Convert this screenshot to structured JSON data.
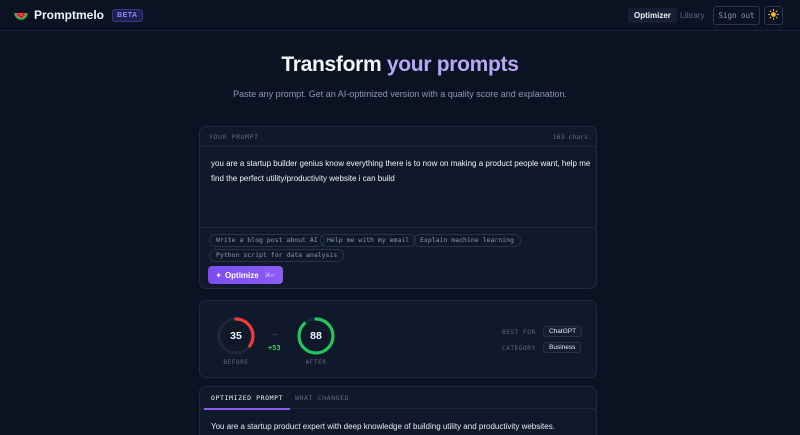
{
  "header": {
    "brand_name": "Promptmelo",
    "badge": "BETA",
    "logo_icon": "watermelon-icon",
    "nav": {
      "optimizer": "Optimizer",
      "library": "Library"
    },
    "sign_out": "Sign out",
    "theme_icon": "sun-icon"
  },
  "hero": {
    "title_part1": "Transform ",
    "title_part2": "your prompts",
    "subtitle": "Paste any prompt. Get an AI-optimized version with a quality score and explanation."
  },
  "prompt": {
    "label": "YOUR PROMPT",
    "char_count": "163 chars",
    "text": "you are a startup builder genius know everything there is to now on making a product people want, help me find the perfect utility/productivity website i can build",
    "suggestions": [
      "Write a blog post about AI",
      "Help me with my email",
      "Explain machine learning",
      "Python script for data analysis"
    ],
    "optimize_label": "Optimize",
    "optimize_icon": "sparkle-icon",
    "shortcut": "⌘↵"
  },
  "score": {
    "before": {
      "value": "35",
      "caption": "BEFORE",
      "fraction": 0.35,
      "color": "#ef3b3b"
    },
    "after": {
      "value": "88",
      "caption": "AFTER",
      "fraction": 0.88,
      "color": "#22c55e"
    },
    "delta": "+53",
    "arrow_icon": "arrow-right-icon",
    "best_for_label": "BEST FOR",
    "best_for_value": "ChatGPT",
    "category_label": "CATEGORY",
    "category_value": "Business"
  },
  "output": {
    "tabs": [
      "OPTIMIZED PROMPT",
      "WHAT CHANGED"
    ],
    "text": "You are a startup product expert with deep knowledge of building utility and productivity websites."
  },
  "colors": {
    "background": "#0b1322",
    "card": "#0f1929",
    "accent": "#8d5cf6",
    "accent_text": "#b7a8f6"
  }
}
